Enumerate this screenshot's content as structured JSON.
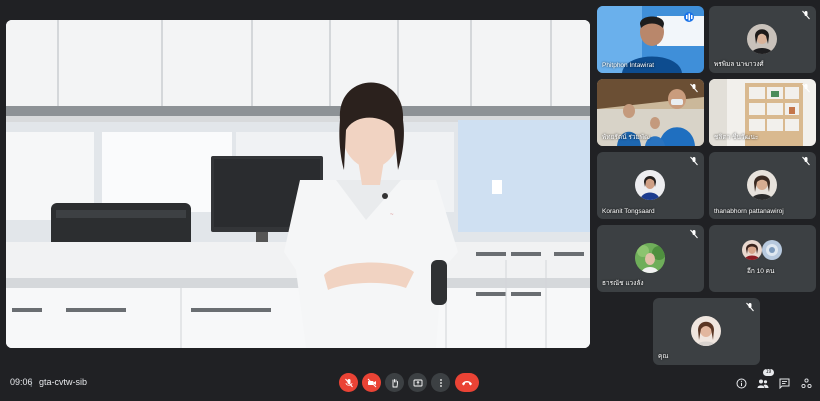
{
  "meeting": {
    "time": "09:06",
    "separator": "|",
    "code": "gta-cvtw-sib"
  },
  "participants": [
    {
      "name": "Phitphon Intawirat"
    },
    {
      "name": "พรพิมล นาฆาวงศ์"
    },
    {
      "name": "พัทยรัตน์ ร่วมพัฒ"
    },
    {
      "name": "ชลิตา ชื่นวัฒนะ"
    },
    {
      "name": "Koranit Tongsaard"
    },
    {
      "name": "thanabhorn pattanawiroj"
    },
    {
      "name": "ธารณัช แวงลัง"
    },
    {
      "name": "อีก 10 คน"
    },
    {
      "name": "คุณ"
    }
  ],
  "people_count": "19",
  "colors": {
    "background": "#202124",
    "end_call": "#ea4335",
    "control": "#3c4043"
  },
  "icons": {
    "mic_off": "mic-off-icon",
    "camera_off": "camera-off-icon",
    "raise_hand": "raise-hand-icon",
    "present": "present-screen-icon",
    "more": "more-options-icon",
    "end_call": "end-call-icon",
    "info": "info-icon",
    "people": "people-icon",
    "chat": "chat-icon",
    "activities": "activities-icon"
  }
}
